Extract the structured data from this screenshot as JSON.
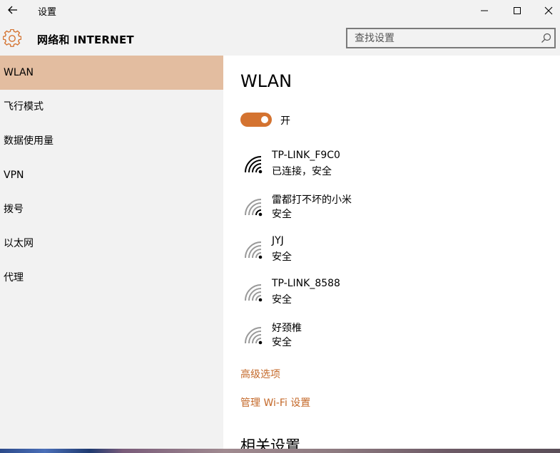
{
  "window": {
    "title": "设置"
  },
  "header": {
    "section_title": "网络和 INTERNET",
    "search_placeholder": "查找设置"
  },
  "sidebar": {
    "items": [
      {
        "label": "WLAN",
        "selected": true
      },
      {
        "label": "飞行模式",
        "selected": false
      },
      {
        "label": "数据使用量",
        "selected": false
      },
      {
        "label": "VPN",
        "selected": false
      },
      {
        "label": "拨号",
        "selected": false
      },
      {
        "label": "以太网",
        "selected": false
      },
      {
        "label": "代理",
        "selected": false
      }
    ]
  },
  "main": {
    "title": "WLAN",
    "toggle": {
      "label": "开",
      "on": true
    },
    "networks": [
      {
        "name": "TP-LINK_F9C0",
        "status": "已连接，安全",
        "connected": true
      },
      {
        "name": "雷都打不坏的小米",
        "status": "安全",
        "connected": false
      },
      {
        "name": "JYJ",
        "status": "安全",
        "connected": false
      },
      {
        "name": "TP-LINK_8588",
        "status": "安全",
        "connected": false
      },
      {
        "name": "好颈椎",
        "status": "安全",
        "connected": false
      }
    ],
    "links": {
      "advanced": "高级选项",
      "manage_wifi": "管理 Wi-Fi 设置"
    },
    "related_title": "相关设置"
  },
  "colors": {
    "accent": "#d47330",
    "link": "#c4692a",
    "selected_bg": "#e3bda0",
    "chrome_bg": "#f2f2f2"
  },
  "icons": {
    "back": "back-arrow-icon",
    "minimize": "minimize-icon",
    "maximize": "maximize-icon",
    "close": "close-icon",
    "settings": "gear-icon",
    "search": "search-icon",
    "wifi": "wifi-icon"
  }
}
